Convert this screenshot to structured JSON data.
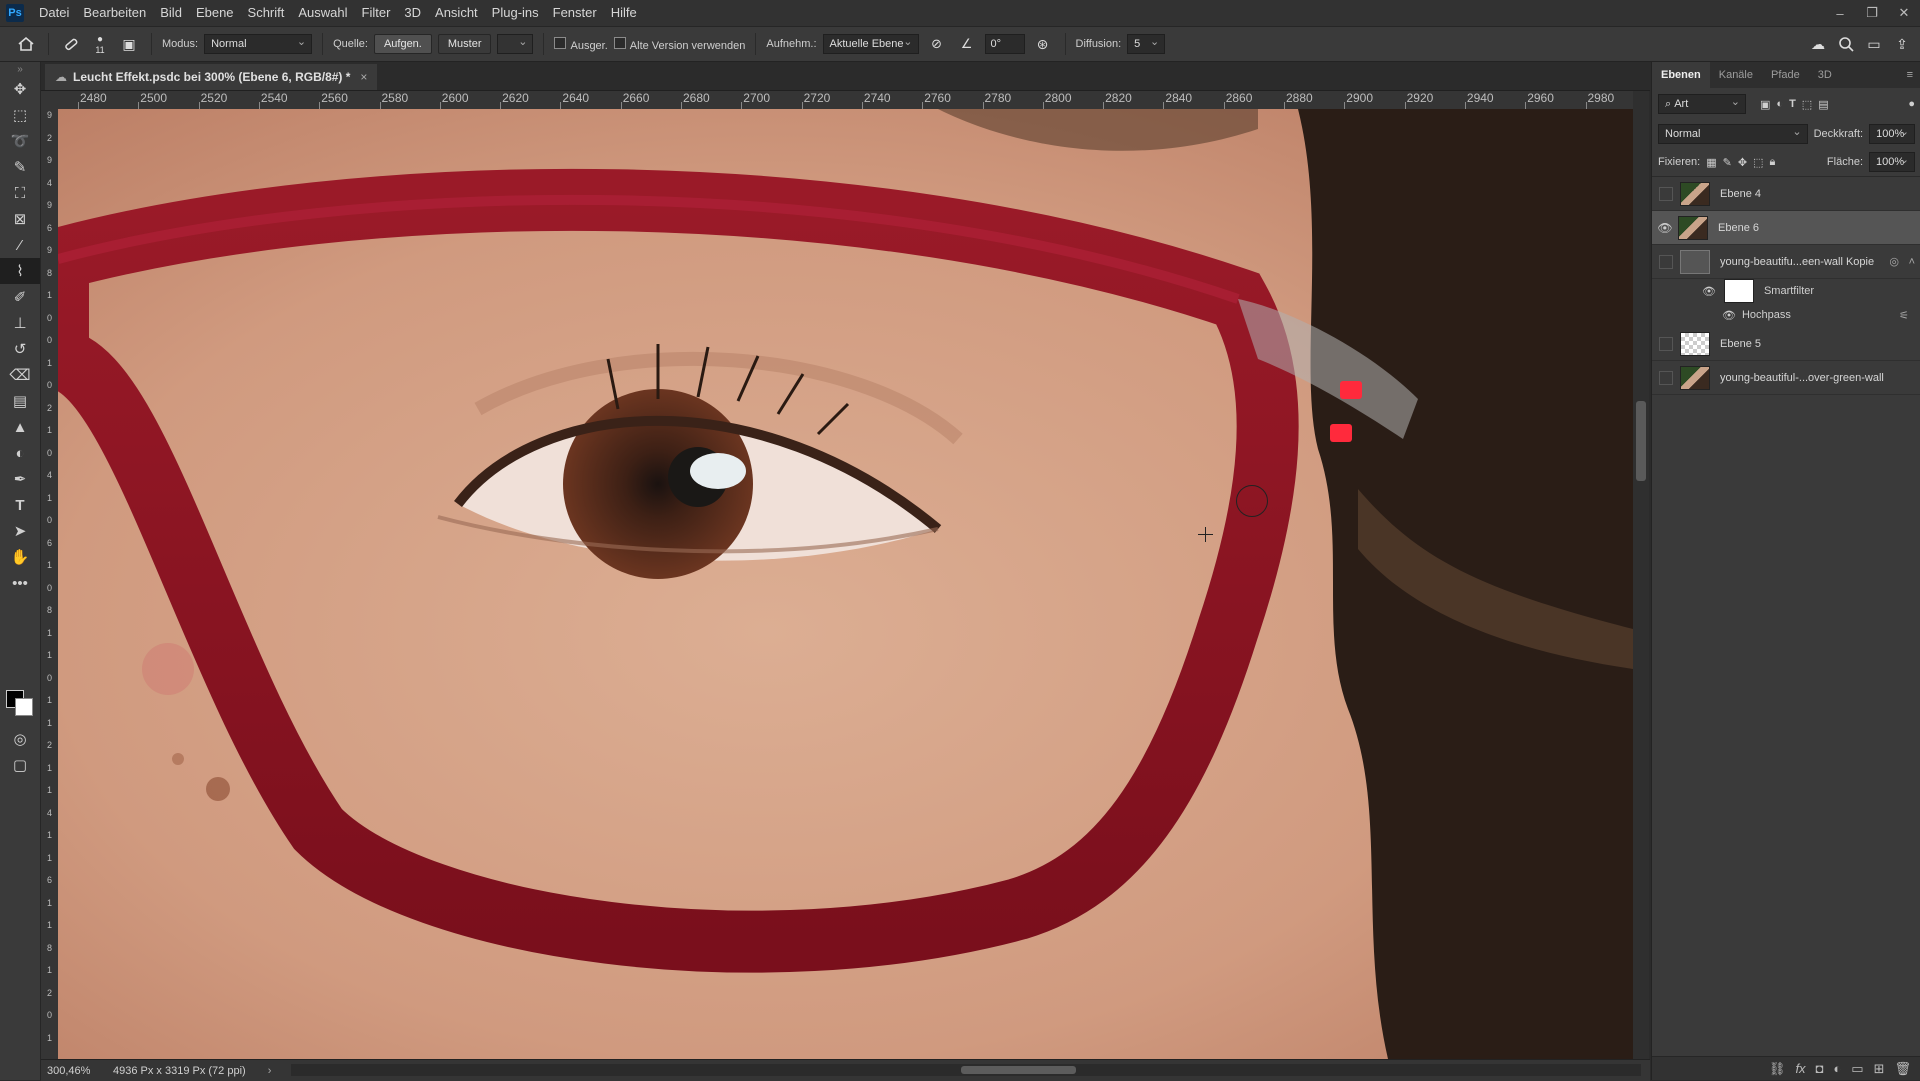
{
  "app": {
    "logo": "Ps"
  },
  "menu": [
    "Datei",
    "Bearbeiten",
    "Bild",
    "Ebene",
    "Schrift",
    "Auswahl",
    "Filter",
    "3D",
    "Ansicht",
    "Plug-ins",
    "Fenster",
    "Hilfe"
  ],
  "window_controls": {
    "minimize": "–",
    "restore": "❐",
    "close": "✕"
  },
  "options": {
    "brush_size": "11",
    "modus_label": "Modus:",
    "modus_value": "Normal",
    "quelle_label": "Quelle:",
    "aufgen_label": "Aufgen.",
    "muster_label": "Muster",
    "ausger_label": "Ausger.",
    "alte_version_label": "Alte Version verwenden",
    "aufnehm_label": "Aufnehm.:",
    "aufnehm_value": "Aktuelle Ebene",
    "angle_value": "0°",
    "diffusion_label": "Diffusion:",
    "diffusion_value": "5"
  },
  "document": {
    "tab_title": "Leucht Effekt.psdc bei 300% (Ebene 6, RGB/8#) *",
    "close": "×"
  },
  "ruler": {
    "top_ticks": [
      "2480",
      "2500",
      "2520",
      "2540",
      "2560",
      "2580",
      "2600",
      "2620",
      "2640",
      "2660",
      "2680",
      "2700",
      "2720",
      "2740",
      "2760",
      "2780",
      "2800",
      "2820",
      "2840",
      "2860",
      "2880",
      "2900",
      "2920",
      "2940",
      "2960",
      "2980"
    ],
    "left_ticks": [
      "9",
      "2",
      "9",
      "4",
      "9",
      "6",
      "9",
      "8",
      "1",
      "0",
      "0",
      "1",
      "0",
      "2",
      "1",
      "0",
      "4",
      "1",
      "0",
      "6",
      "1",
      "0",
      "8",
      "1",
      "1",
      "0",
      "1",
      "1",
      "2",
      "1",
      "1",
      "4",
      "1",
      "1",
      "6",
      "1",
      "1",
      "8",
      "1",
      "2",
      "0",
      "1"
    ]
  },
  "status": {
    "zoom": "300,46%",
    "doc_size": "4936 Px x 3319 Px (72 ppi)",
    "arrow": "›"
  },
  "panel": {
    "tabs": [
      "Ebenen",
      "Kanäle",
      "Pfade",
      "3D"
    ],
    "filter_kind": "Art",
    "blend_mode": "Normal",
    "opacity_label": "Deckkraft:",
    "opacity_value": "100%",
    "lock_label": "Fixieren:",
    "fill_label": "Fläche:",
    "fill_value": "100%",
    "layers": [
      {
        "name": "Ebene 4",
        "visible": false,
        "selected": false,
        "thumb": "photo"
      },
      {
        "name": "Ebene 6",
        "visible": true,
        "selected": true,
        "thumb": "photo"
      },
      {
        "name": "young-beautifu...een-wall Kopie",
        "visible": false,
        "selected": false,
        "thumb": "smart"
      },
      {
        "name": "Ebene 5",
        "visible": false,
        "selected": false,
        "thumb": "checker"
      },
      {
        "name": "young-beautiful-...over-green-wall",
        "visible": false,
        "selected": false,
        "thumb": "photo"
      }
    ],
    "smartfilter_label": "Smartfilter",
    "hochpass_label": "Hochpass"
  },
  "colors": {
    "frame": "#8e1422",
    "skin": "#d39c82",
    "hair": "#2a1d16",
    "iris": "#5a2d1c",
    "accent": "#31a8ff"
  },
  "icons": {
    "home": "home-icon",
    "brush": "healing-brush-icon",
    "cursor": "brush-cursor-icon"
  }
}
